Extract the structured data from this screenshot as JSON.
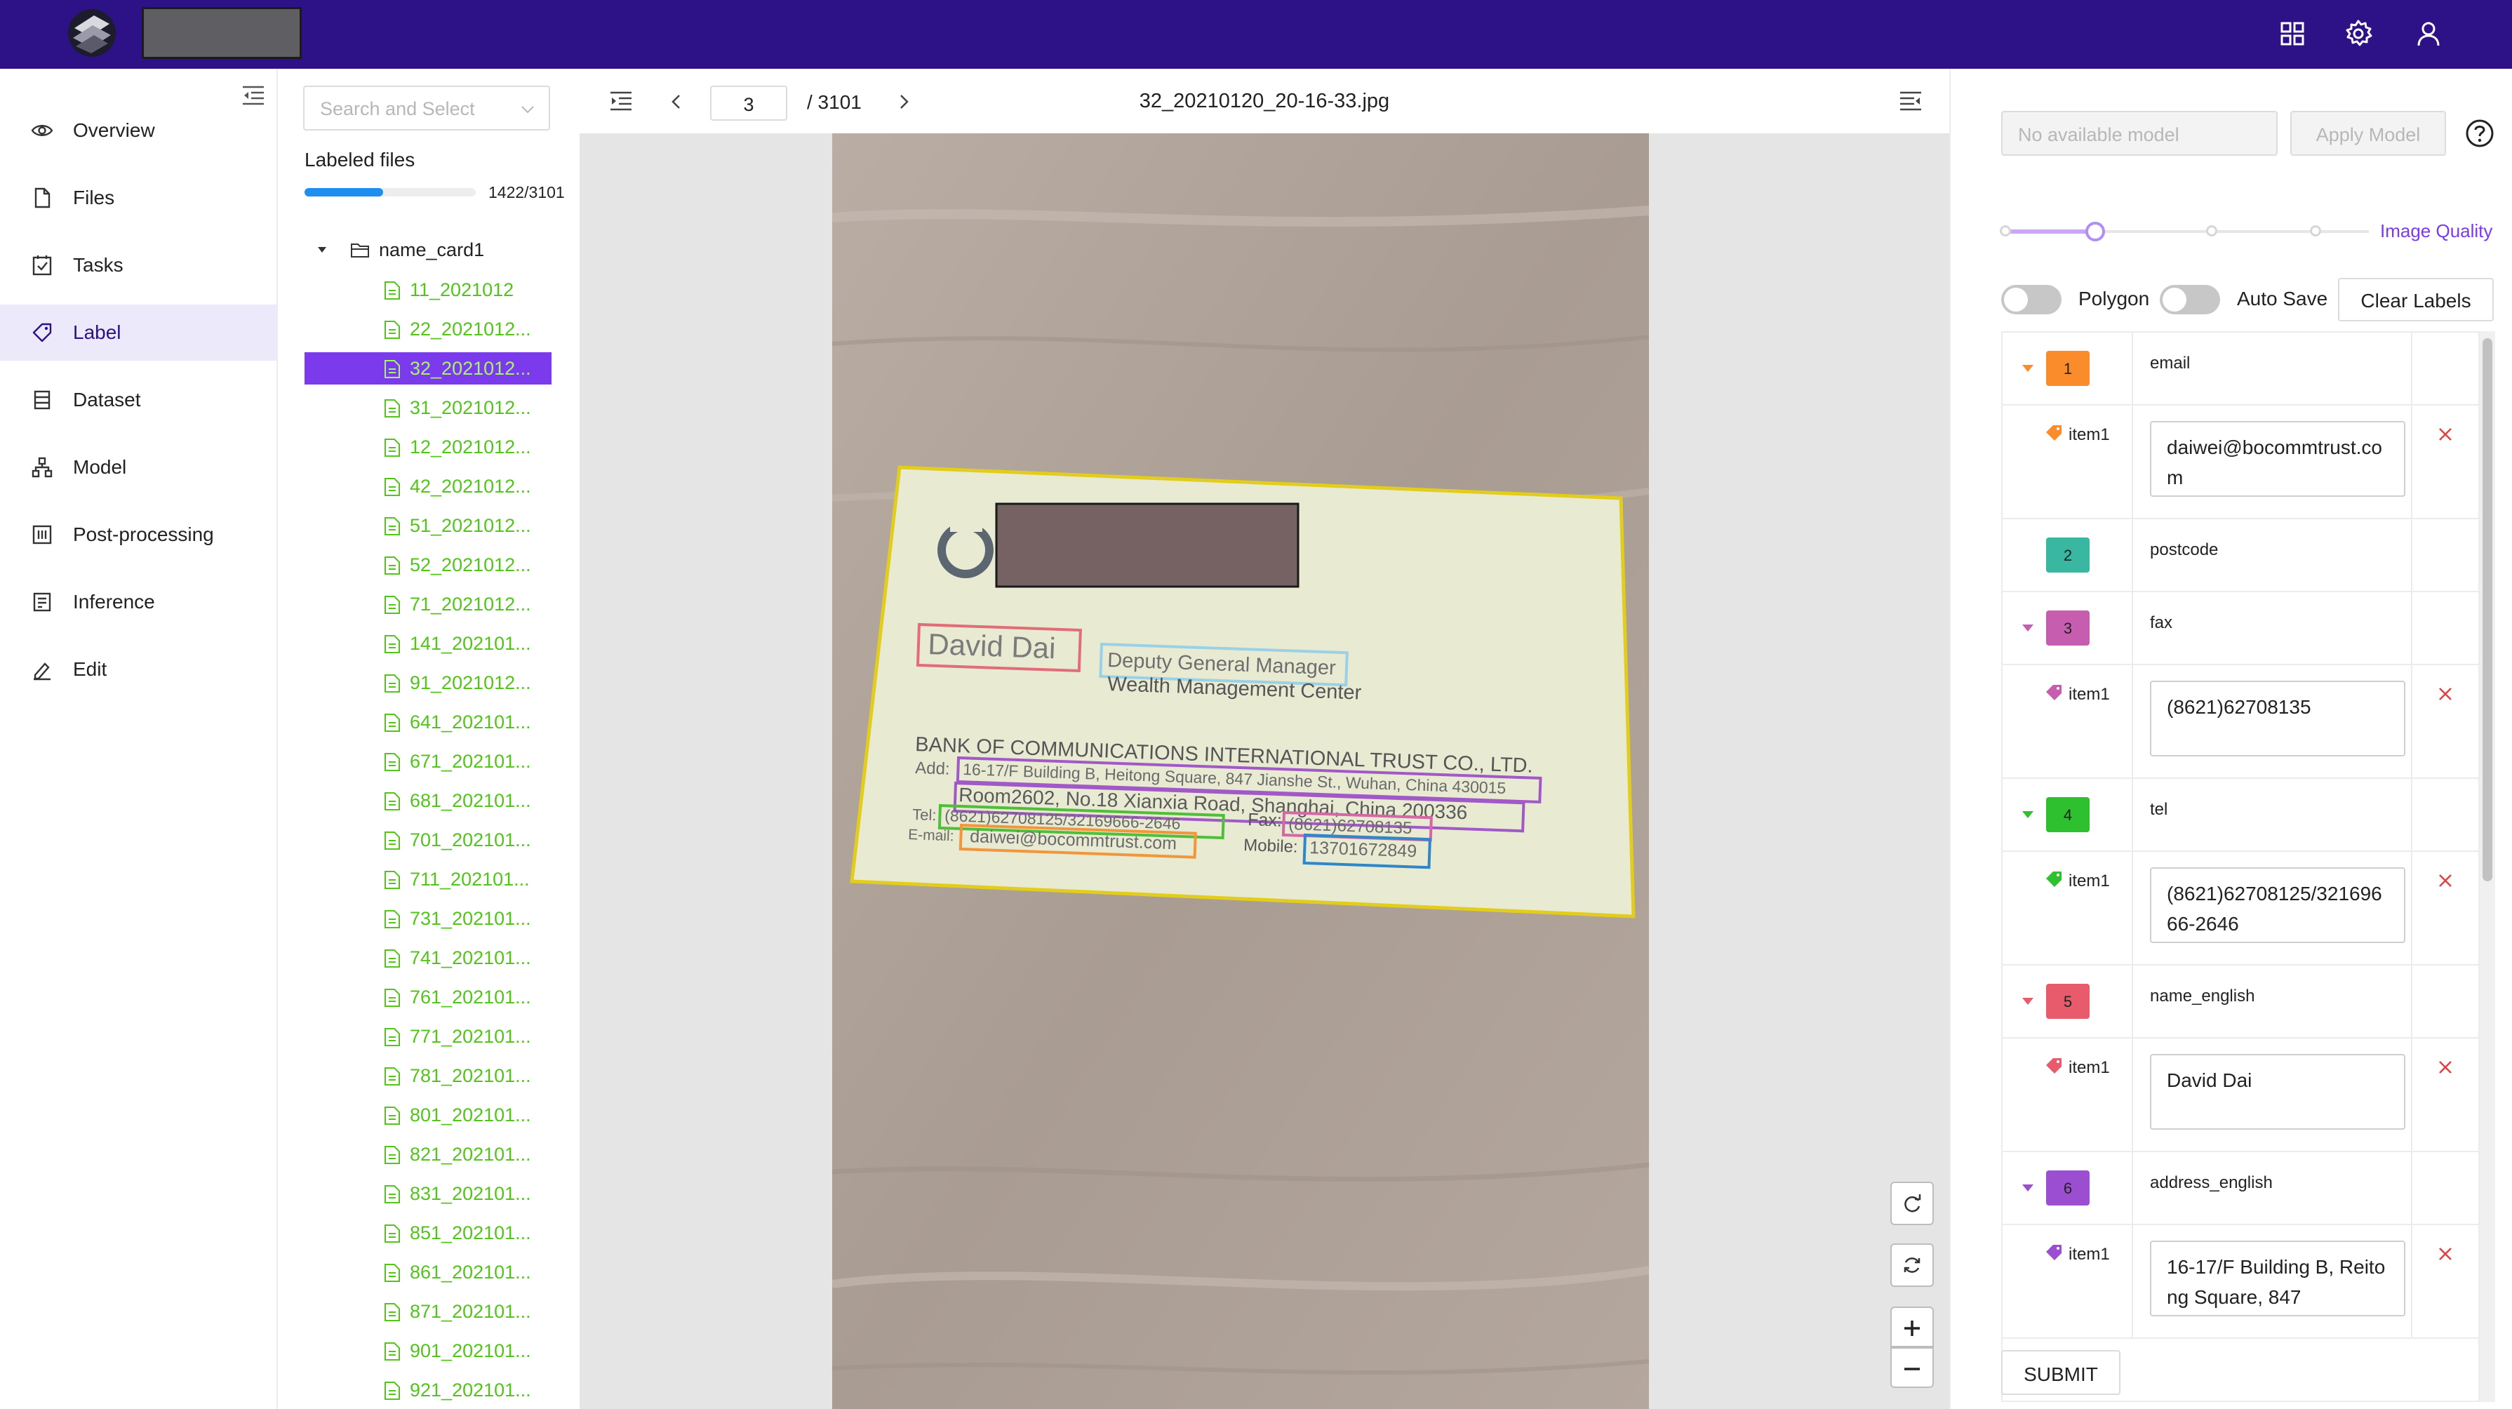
{
  "nav": {
    "items": [
      {
        "label": "Overview",
        "icon": "eye-icon"
      },
      {
        "label": "Files",
        "icon": "file-icon"
      },
      {
        "label": "Tasks",
        "icon": "checkbox-icon"
      },
      {
        "label": "Label",
        "icon": "tag-icon"
      },
      {
        "label": "Dataset",
        "icon": "database-icon"
      },
      {
        "label": "Model",
        "icon": "model-icon"
      },
      {
        "label": "Post-processing",
        "icon": "post-processing-icon"
      },
      {
        "label": "Inference",
        "icon": "inference-icon"
      },
      {
        "label": "Edit",
        "icon": "edit-icon"
      }
    ],
    "active": "Label"
  },
  "files": {
    "search_placeholder": "Search and Select",
    "labeled_title": "Labeled files",
    "progress_text": "1422/3101",
    "progress_fraction": 0.4586,
    "folder": "name_card1",
    "list": [
      "11_2021012",
      "22_2021012...",
      "32_2021012...",
      "31_2021012...",
      "12_2021012...",
      "42_2021012...",
      "51_2021012...",
      "52_2021012...",
      "71_2021012...",
      "141_202101...",
      "91_2021012...",
      "641_202101...",
      "671_202101...",
      "681_202101...",
      "701_202101...",
      "711_202101...",
      "731_202101...",
      "741_202101...",
      "761_202101...",
      "771_202101...",
      "781_202101...",
      "801_202101...",
      "821_202101...",
      "831_202101...",
      "851_202101...",
      "861_202101...",
      "871_202101...",
      "901_202101...",
      "921_202101..."
    ],
    "selected_index": 2
  },
  "viewer": {
    "page_value": "3",
    "page_total": "/  3101",
    "filename": "32_20210120_20-16-33.jpg"
  },
  "card": {
    "name": "David Dai",
    "title": "Deputy General Manager",
    "dept": "Wealth Management Center",
    "company": "BANK OF COMMUNICATIONS INTERNATIONAL TRUST CO., LTD.",
    "add_label": "Add:",
    "addr1": "16-17/F Building B, Heitong Square, 847 Jianshe St., Wuhan, China 430015",
    "addr2": "Room2602, No.18 Xianxia Road, Shanghai, China 200336",
    "tel_label": "Tel:",
    "tel": "(8621)62708125/32169666-2646",
    "fax_label": "Fax:",
    "fax": "(8621)62708135",
    "email_label": "E-mail:",
    "email": "daiwei@bocommtrust.com",
    "mobile_label": "Mobile:",
    "mobile": "13701672849"
  },
  "right": {
    "model_placeholder": "No available model",
    "apply_label": "Apply Model",
    "quality_label": "Image Quality",
    "quality_fraction": 0.25,
    "polygon_label": "Polygon",
    "autosave_label": "Auto Save",
    "clear_label": "Clear Labels",
    "submit_label": "SUBMIT",
    "categories": [
      {
        "num": "1",
        "name": "email",
        "color": "#fa8c2b",
        "item_label": "item1",
        "value": "daiwei@bocommtrust.com"
      },
      {
        "num": "2",
        "name": "postcode",
        "color": "#3ab7a0"
      },
      {
        "num": "3",
        "name": "fax",
        "color": "#c65dae",
        "item_label": "item1",
        "value": "(8621)62708135"
      },
      {
        "num": "4",
        "name": "tel",
        "color": "#2ec02e",
        "item_label": "item1",
        "value": "(8621)62708125/32169666-2646"
      },
      {
        "num": "5",
        "name": "name_english",
        "color": "#e85b6c",
        "item_label": "item1",
        "value": "David Dai"
      },
      {
        "num": "6",
        "name": "address_english",
        "color": "#9b4fd0",
        "item_label": "item1",
        "value": "16-17/F Building B, Reitong Square, 847"
      }
    ]
  },
  "colors": {
    "topbar": "#2d1187",
    "accent": "#7c3aed",
    "file_green": "#52c41a"
  }
}
